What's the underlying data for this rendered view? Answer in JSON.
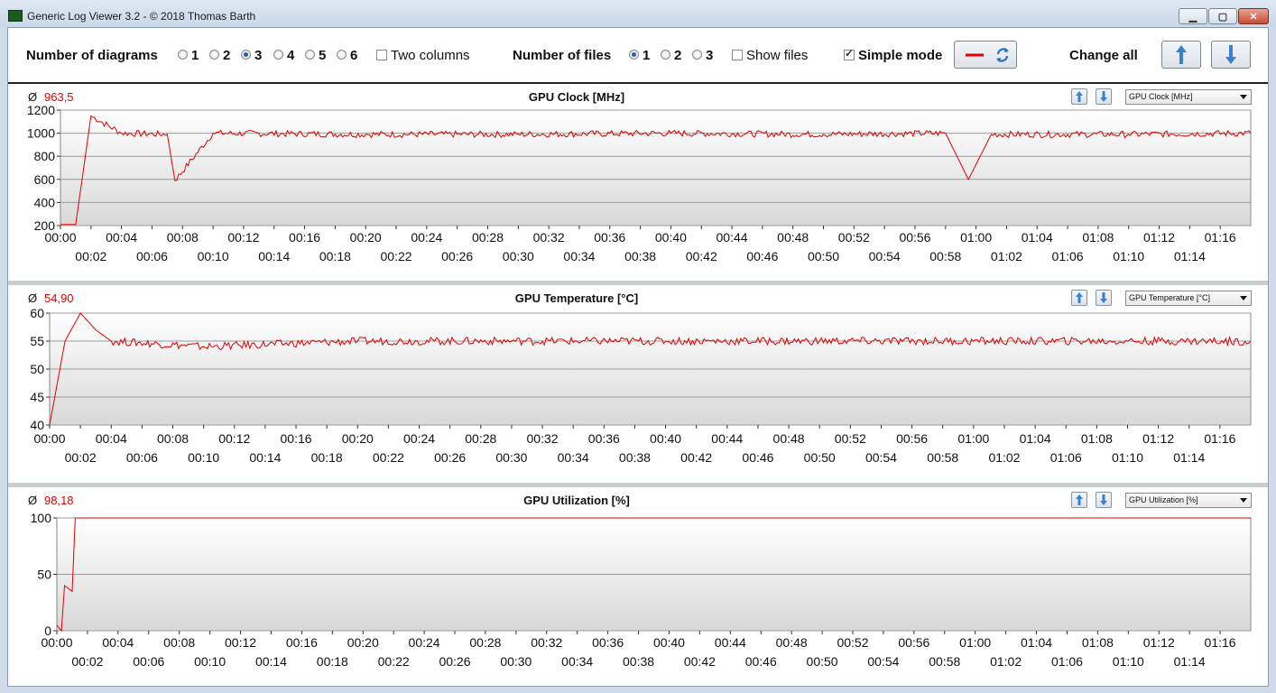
{
  "window": {
    "title": "Generic Log Viewer 3.2 - © 2018 Thomas Barth"
  },
  "toolbar": {
    "diagrams_label": "Number of diagrams",
    "diagram_options": [
      "1",
      "2",
      "3",
      "4",
      "5",
      "6"
    ],
    "diagram_selected": "3",
    "two_columns_label": "Two columns",
    "two_columns_checked": false,
    "files_label": "Number of files",
    "file_options": [
      "1",
      "2",
      "3"
    ],
    "file_selected": "1",
    "show_files_label": "Show files",
    "show_files_checked": false,
    "simple_mode_label": "Simple mode",
    "simple_mode_checked": true,
    "change_all_label": "Change all"
  },
  "colors": {
    "line": "#e00000",
    "accent": "#2a6fc0"
  },
  "icons": {
    "up": "arrow-up-icon",
    "down": "arrow-down-icon",
    "swap": "refresh-icon"
  },
  "x_axis": {
    "top_ticks": [
      "00:00",
      "00:04",
      "00:08",
      "00:12",
      "00:16",
      "00:20",
      "00:24",
      "00:28",
      "00:32",
      "00:36",
      "00:40",
      "00:44",
      "00:48",
      "00:52",
      "00:56",
      "01:00",
      "01:04",
      "01:08",
      "01:12",
      "01:16"
    ],
    "bottom_ticks": [
      "00:02",
      "00:06",
      "00:10",
      "00:14",
      "00:18",
      "00:22",
      "00:26",
      "00:30",
      "00:34",
      "00:38",
      "00:42",
      "00:46",
      "00:50",
      "00:54",
      "00:58",
      "01:02",
      "01:06",
      "01:10",
      "01:14"
    ]
  },
  "panels": [
    {
      "title": "GPU Clock [MHz]",
      "avg_symbol": "Ø",
      "avg": "963,5",
      "select": "GPU Clock [MHz]"
    },
    {
      "title": "GPU Temperature [°C]",
      "avg_symbol": "Ø",
      "avg": "54,90",
      "select": "GPU Temperature [°C]"
    },
    {
      "title": "GPU Utilization [%]",
      "avg_symbol": "Ø",
      "avg": "98,18",
      "select": "GPU Utilization [%]"
    }
  ],
  "chart_data": [
    {
      "type": "line",
      "title": "GPU Clock [MHz]",
      "xlabel": "",
      "ylabel": "",
      "xlim": [
        "00:00",
        "01:18"
      ],
      "ylim": [
        200,
        1200
      ],
      "yticks": [
        200,
        400,
        600,
        800,
        1000,
        1200
      ],
      "grid": true,
      "series": [
        {
          "x": [
            "00:00",
            "00:01",
            "00:02",
            "00:04",
            "00:07",
            "00:07.5",
            "00:10",
            "00:20",
            "00:30",
            "00:40",
            "00:50",
            "00:58",
            "00:59.5",
            "01:01",
            "01:10",
            "01:18"
          ],
          "values": [
            210,
            210,
            1150,
            1000,
            990,
            590,
            1000,
            990,
            990,
            1000,
            990,
            1000,
            600,
            990,
            990,
            1000
          ]
        }
      ]
    },
    {
      "type": "line",
      "title": "GPU Temperature [°C]",
      "xlabel": "",
      "ylabel": "",
      "xlim": [
        "00:00",
        "01:18"
      ],
      "ylim": [
        40,
        60
      ],
      "yticks": [
        40,
        45,
        50,
        55,
        60
      ],
      "grid": true,
      "series": [
        {
          "x": [
            "00:00",
            "00:01",
            "00:02",
            "00:03",
            "00:04",
            "00:10",
            "00:20",
            "00:30",
            "00:40",
            "00:50",
            "01:00",
            "01:10",
            "01:18"
          ],
          "values": [
            40,
            55,
            60,
            57,
            55,
            54,
            55,
            55,
            55,
            55,
            55,
            55,
            55
          ]
        }
      ]
    },
    {
      "type": "line",
      "title": "GPU Utilization [%]",
      "xlabel": "",
      "ylabel": "",
      "xlim": [
        "00:00",
        "01:18"
      ],
      "ylim": [
        0,
        100
      ],
      "yticks": [
        0,
        50,
        100
      ],
      "grid": true,
      "series": [
        {
          "x": [
            "00:00",
            "00:00.3",
            "00:00.5",
            "00:01",
            "00:01.2",
            "00:10",
            "00:30",
            "01:00",
            "01:18"
          ],
          "values": [
            5,
            0,
            40,
            35,
            100,
            100,
            100,
            100,
            100
          ]
        }
      ]
    }
  ]
}
